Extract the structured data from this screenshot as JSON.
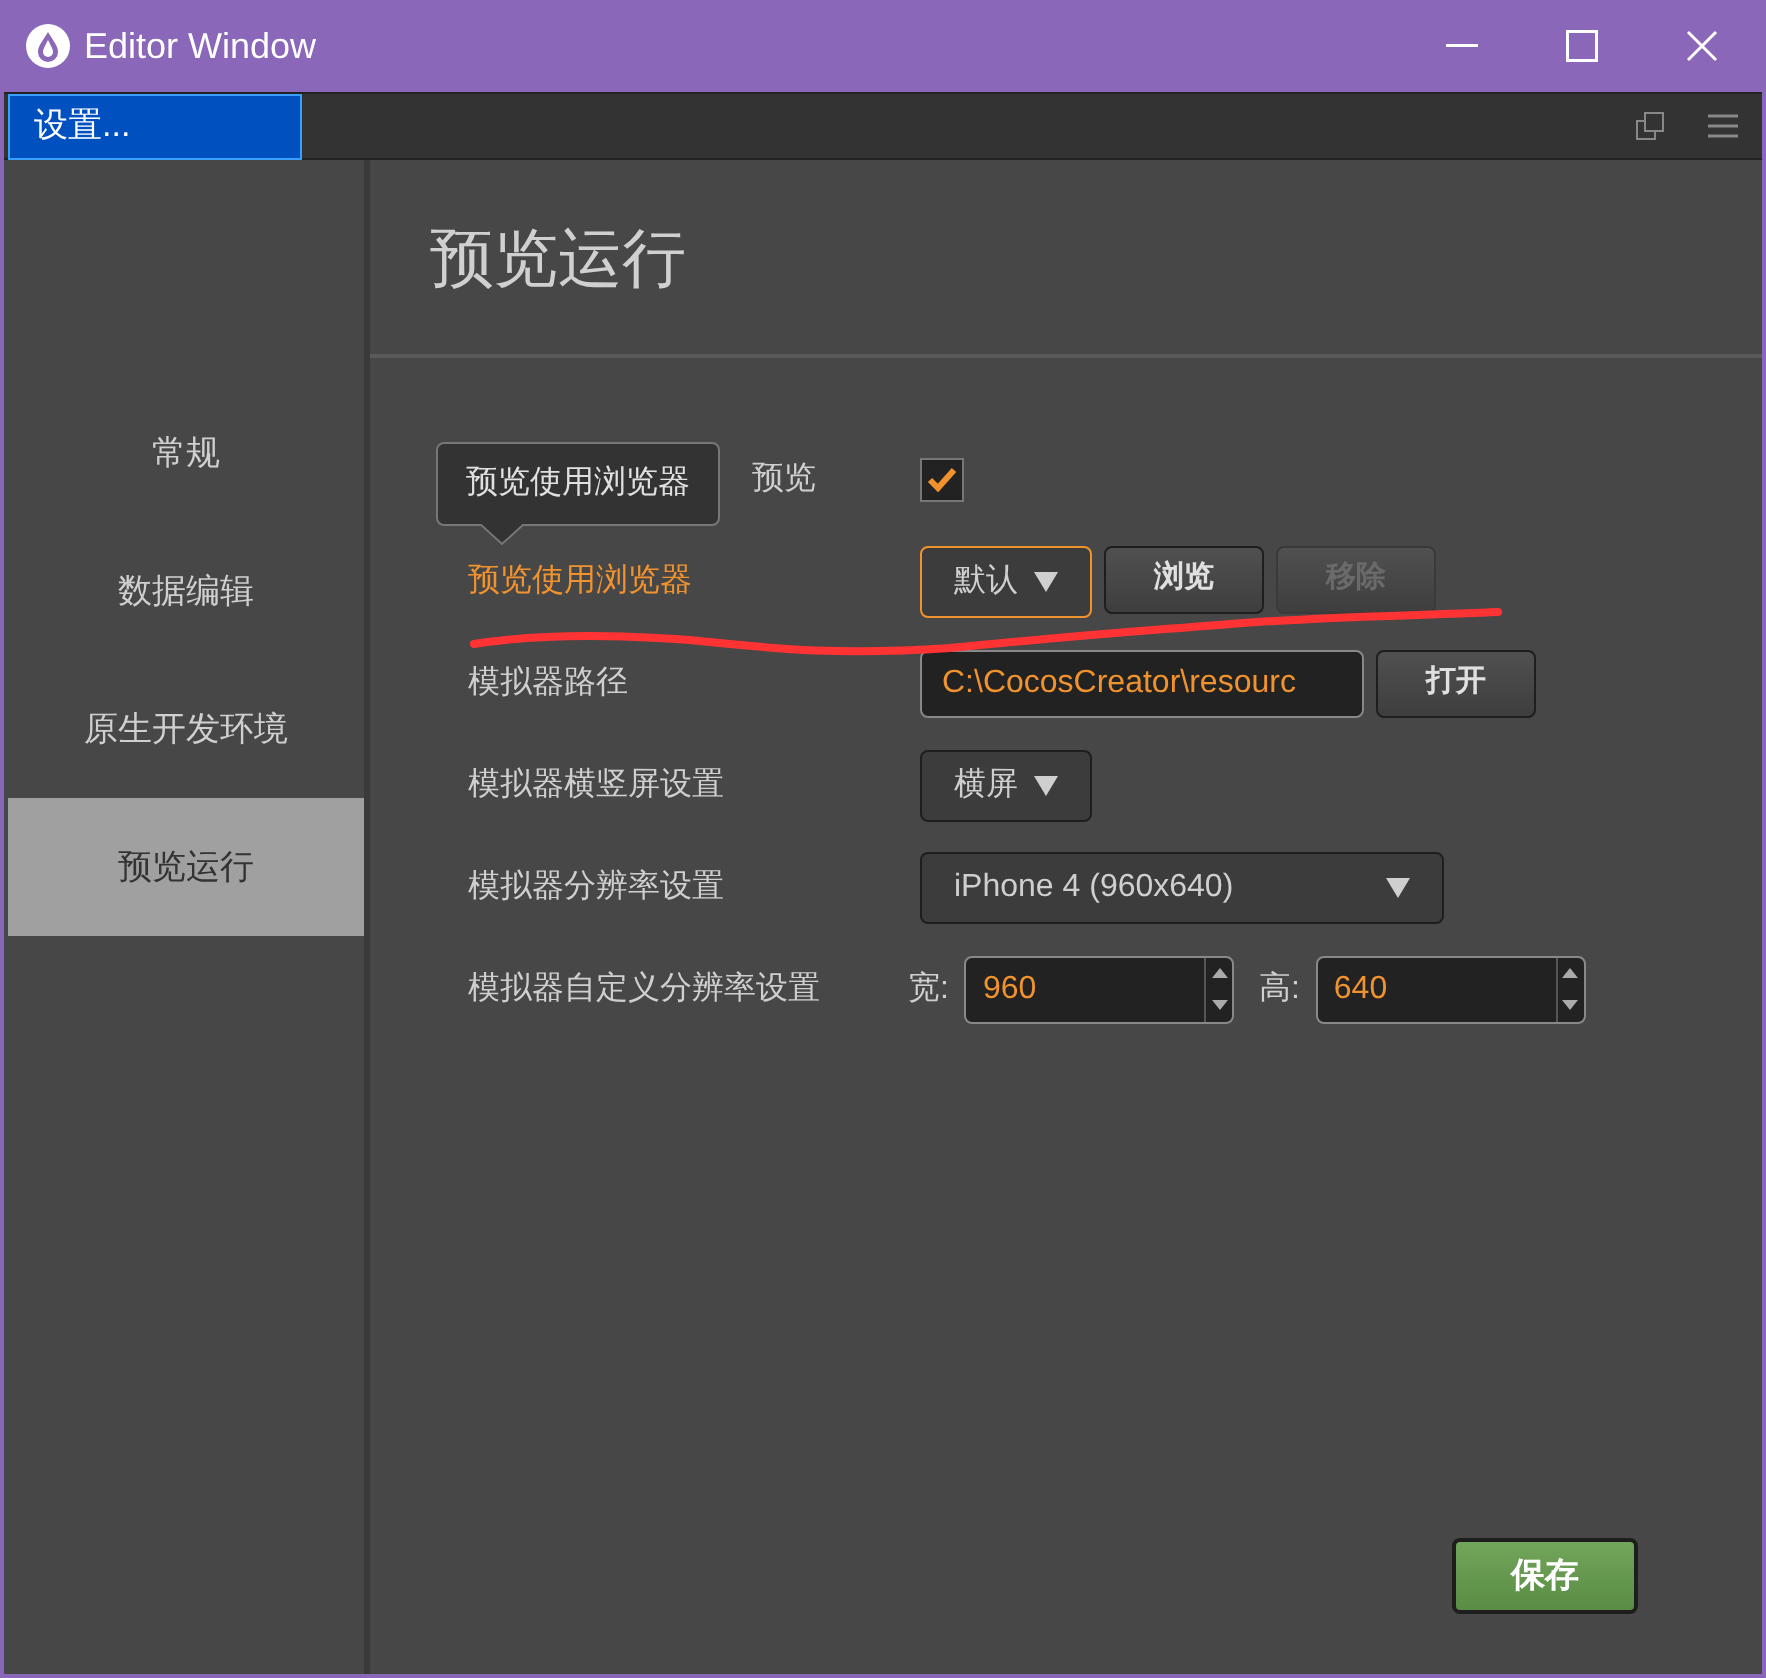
{
  "window": {
    "title": "Editor Window"
  },
  "tab": {
    "label": "设置...",
    "selected": true
  },
  "sidebar": {
    "items": [
      {
        "label": "常规",
        "selected": false
      },
      {
        "label": "数据编辑",
        "selected": false
      },
      {
        "label": "原生开发环境",
        "selected": false
      },
      {
        "label": "预览运行",
        "selected": true
      }
    ]
  },
  "heading": "预览运行",
  "tooltip": "预览使用浏览器",
  "rows": [
    {
      "kind": "checkbox",
      "label": "预览",
      "checked": true,
      "highlighted": false
    },
    {
      "kind": "browser",
      "label": "预览使用浏览器",
      "highlighted": true,
      "select": "默认",
      "buttons": [
        {
          "label": "浏览",
          "disabled": false
        },
        {
          "label": "移除",
          "disabled": true
        }
      ]
    },
    {
      "kind": "path",
      "label": "模拟器路径",
      "highlighted": false,
      "value": "C:\\CocosCreator\\resourc",
      "button": "打开"
    },
    {
      "kind": "select",
      "label": "模拟器横竖屏设置",
      "highlighted": false,
      "select": "横屏",
      "wide": false
    },
    {
      "kind": "select",
      "label": "模拟器分辨率设置",
      "highlighted": false,
      "select": "iPhone 4 (960x640)",
      "wide": true
    },
    {
      "kind": "size",
      "label": "模拟器自定义分辨率设置",
      "highlighted": false,
      "fields": [
        {
          "label": "宽:",
          "value": "960"
        },
        {
          "label": "高:",
          "value": "640"
        }
      ]
    }
  ],
  "save_button": "保存"
}
